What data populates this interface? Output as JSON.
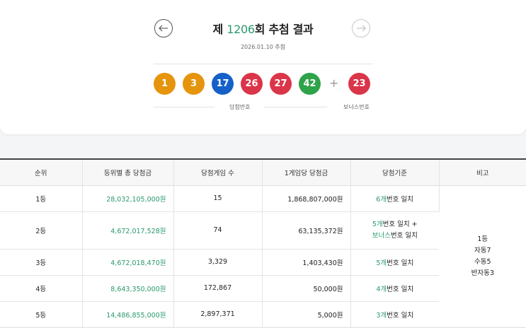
{
  "header": {
    "title_prefix": "제",
    "round": "1206",
    "title_suffix": "회 추첨 결과",
    "date": "2026.01.10 추첨"
  },
  "balls": [
    {
      "number": "1",
      "color": "#e5940c"
    },
    {
      "number": "3",
      "color": "#e5940c"
    },
    {
      "number": "17",
      "color": "#1560c9"
    },
    {
      "number": "26",
      "color": "#db3549"
    },
    {
      "number": "27",
      "color": "#db3549"
    },
    {
      "number": "42",
      "color": "#2ea34a"
    }
  ],
  "plus": "+",
  "bonus": {
    "number": "23",
    "color": "#db3549"
  },
  "captions": {
    "winning": "당첨번호",
    "bonus": "보너스번호"
  },
  "table": {
    "headers": [
      "순위",
      "등위별 총 당첨금",
      "당첨게임 수",
      "1게임당 당첨금",
      "당첨기준",
      "비고"
    ],
    "rows": [
      {
        "rank": "1등",
        "total": "28,032,105,000원",
        "count": "15",
        "per": "1,868,807,000원",
        "crit_hi": "6개",
        "crit_rest": "번호 일치"
      },
      {
        "rank": "2등",
        "total": "4,672,017,528원",
        "count": "74",
        "per": "63,135,372원",
        "crit_hi": "5개",
        "crit_rest": "번호 일치 +",
        "crit_hi2": "보너스",
        "crit_rest2": "번호 일치"
      },
      {
        "rank": "3등",
        "total": "4,672,018,470원",
        "count": "3,329",
        "per": "1,403,430원",
        "crit_hi": "5개",
        "crit_rest": "번호 일치"
      },
      {
        "rank": "4등",
        "total": "8,643,350,000원",
        "count": "172,867",
        "per": "50,000원",
        "crit_hi": "4개",
        "crit_rest": "번호 일치"
      },
      {
        "rank": "5등",
        "total": "14,486,855,000원",
        "count": "2,897,371",
        "per": "5,000원",
        "crit_hi": "3개",
        "crit_rest": "번호 일치"
      }
    ],
    "note": [
      "1등",
      "자동7",
      "수동5",
      "반자동3"
    ]
  }
}
